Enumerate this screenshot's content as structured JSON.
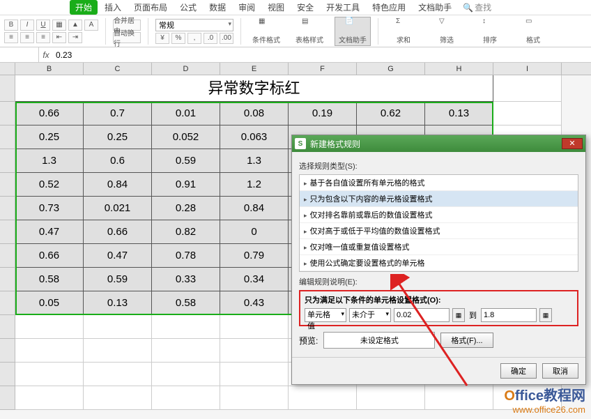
{
  "tabs": [
    "开始",
    "插入",
    "页面布局",
    "公式",
    "数据",
    "审阅",
    "视图",
    "安全",
    "开发工具",
    "特色应用",
    "文档助手"
  ],
  "active_tab_index": 0,
  "search_placeholder": "查找",
  "toolbar": {
    "number_format": "常规",
    "cond_fmt": "条件格式",
    "cell_style": "表格样式",
    "doc_helper": "文档助手",
    "sum": "求和",
    "filter": "筛选",
    "sort": "排序",
    "format": "格式",
    "merge": "合并居中",
    "wrap": "自动换行"
  },
  "formula_bar": {
    "fx": "fx",
    "value": "0.23"
  },
  "columns": [
    "B",
    "C",
    "D",
    "E",
    "F",
    "G",
    "H",
    "I"
  ],
  "title_cell": "异常数字标红",
  "data": [
    [
      "0.66",
      "0.7",
      "0.01",
      "0.08",
      "0.19",
      "0.62",
      "0.13"
    ],
    [
      "0.25",
      "0.25",
      "0.052",
      "0.063",
      "",
      "",
      ""
    ],
    [
      "1.3",
      "0.6",
      "0.59",
      "1.3",
      "",
      "",
      ""
    ],
    [
      "0.52",
      "0.84",
      "0.91",
      "1.2",
      "",
      "",
      ""
    ],
    [
      "0.73",
      "0.021",
      "0.28",
      "0.84",
      "",
      "",
      ""
    ],
    [
      "0.47",
      "0.66",
      "0.82",
      "0",
      "",
      "",
      ""
    ],
    [
      "0.66",
      "0.47",
      "0.78",
      "0.79",
      "",
      "",
      ""
    ],
    [
      "0.58",
      "0.59",
      "0.33",
      "0.34",
      "",
      "",
      ""
    ],
    [
      "0.05",
      "0.13",
      "0.58",
      "0.43",
      "",
      "",
      ""
    ]
  ],
  "dialog": {
    "title": "新建格式规则",
    "section_select": "选择规则类型(S):",
    "rule_types": [
      "基于各自值设置所有单元格的格式",
      "只为包含以下内容的单元格设置格式",
      "仅对排名靠前或靠后的数值设置格式",
      "仅对高于或低于平均值的数值设置格式",
      "仅对唯一值或重复值设置格式",
      "使用公式确定要设置格式的单元格"
    ],
    "selected_rule_index": 1,
    "section_edit": "编辑规则说明(E):",
    "cond_header": "只为满足以下条件的单元格设置格式(O):",
    "cell_value_label": "单元格值",
    "operator": "未介于",
    "val1": "0.02",
    "to": "到",
    "val2": "1.8",
    "preview_label": "预览:",
    "preview_text": "未设定格式",
    "format_btn": "格式(F)...",
    "ok": "确定",
    "cancel": "取消"
  },
  "watermark": {
    "line1a": "O",
    "line1b": "ffice教程网",
    "line2": "www.office26.com"
  }
}
